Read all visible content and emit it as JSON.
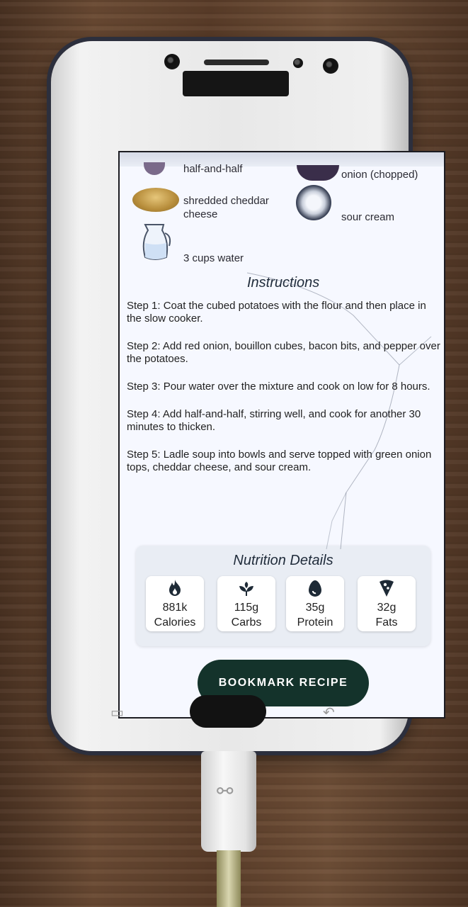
{
  "ingredients": {
    "half_and_half": "half-and-half",
    "onion_chopped": "onion (chopped)",
    "shredded_cheddar_line1": "shredded cheddar",
    "shredded_cheddar_line2": "cheese",
    "sour_cream": "sour cream",
    "water": "3 cups water"
  },
  "instructions": {
    "title": "Instructions",
    "steps": [
      "Step 1: Coat the cubed potatoes with the flour and then place in the slow cooker.",
      "Step 2: Add red onion, bouillon cubes, bacon bits, and pepper over the potatoes.",
      "Step 3: Pour water over the mixture and cook on low for 8 hours.",
      "Step 4: Add half-and-half, stirring well, and cook for another 30 minutes to thicken.",
      "Step 5: Ladle soup into bowls and serve topped with green onion tops, cheddar cheese, and sour cream."
    ]
  },
  "nutrition": {
    "title": "Nutrition Details",
    "items": [
      {
        "value": "881k",
        "label": "Calories",
        "icon": "flame-icon"
      },
      {
        "value": "115g",
        "label": "Carbs",
        "icon": "sprout-icon"
      },
      {
        "value": "35g",
        "label": "Protein",
        "icon": "egg-icon"
      },
      {
        "value": "32g",
        "label": "Fats",
        "icon": "pizza-slice-icon"
      }
    ]
  },
  "actions": {
    "bookmark_label": "BOOKMARK RECIPE"
  },
  "colors": {
    "button_bg": "#14332b",
    "screen_bg": "#f6f8ff",
    "title_color": "#1f2b3a"
  }
}
